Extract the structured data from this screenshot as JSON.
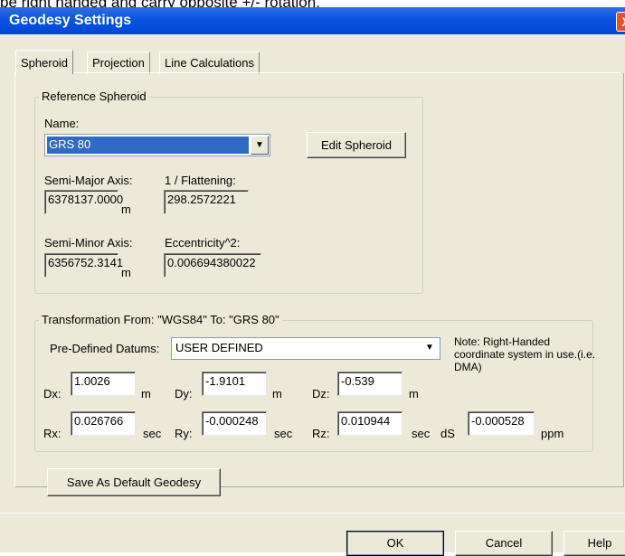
{
  "top_caption": "be right handed and carry opposite +/- rotation.",
  "window": {
    "title": "Geodesy Settings",
    "close_glyph": "X"
  },
  "tabs": [
    {
      "label": "Spheroid"
    },
    {
      "label": "Projection"
    },
    {
      "label": "Line Calculations"
    }
  ],
  "reference_spheroid": {
    "legend": "Reference Spheroid",
    "name_label": "Name:",
    "name_value": "GRS 80",
    "edit_button": "Edit Spheroid",
    "semi_major_label": "Semi-Major Axis:",
    "semi_major_value": "6378137.0000",
    "semi_major_unit": "m",
    "flattening_label": "1 / Flattening:",
    "flattening_value": "298.2572221",
    "semi_minor_label": "Semi-Minor Axis:",
    "semi_minor_value": "6356752.3141",
    "semi_minor_unit": "m",
    "eccentricity_label": "Eccentricity^2:",
    "eccentricity_value": "0.006694380022"
  },
  "transformation": {
    "legend": "Transformation From: \"WGS84\" To: \"GRS 80\"",
    "datums_label": "Pre-Defined Datums:",
    "datums_value": "USER DEFINED",
    "note": "Note: Right-Handed coordinate system in use.(i.e. DMA)",
    "dx_label": "Dx:",
    "dx_value": "1.0026",
    "dx_unit": "m",
    "dy_label": "Dy:",
    "dy_value": "-1.9101",
    "dy_unit": "m",
    "dz_label": "Dz:",
    "dz_value": "-0.539",
    "dz_unit": "m",
    "rx_label": "Rx:",
    "rx_value": "0.026766",
    "rx_unit": "sec",
    "ry_label": "Ry:",
    "ry_value": "-0.000248",
    "ry_unit": "sec",
    "rz_label": "Rz:",
    "rz_value": "0.010944",
    "rz_unit": "sec",
    "ds_label": "dS",
    "ds_value": "-0.000528",
    "ds_unit": "ppm"
  },
  "buttons": {
    "save_default": "Save As Default Geodesy",
    "ok": "OK",
    "cancel": "Cancel",
    "help": "Help"
  },
  "colors": {
    "titlebar": "#0a54e0",
    "dialog_bg": "#ece9d8",
    "selection": "#316ac5"
  }
}
